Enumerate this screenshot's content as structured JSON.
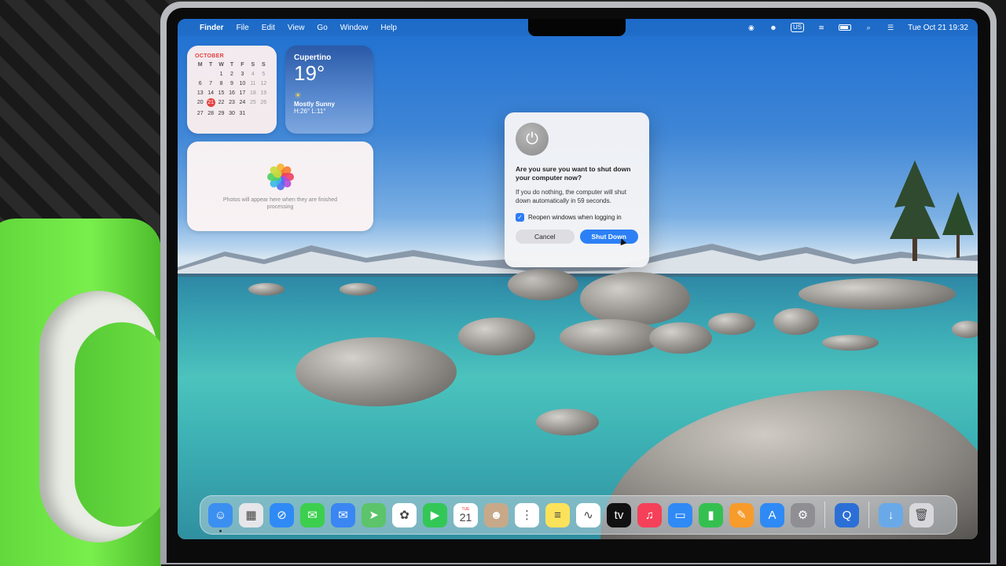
{
  "menubar": {
    "apple_icon": "apple-icon",
    "app_name": "Finder",
    "menus": [
      "File",
      "Edit",
      "View",
      "Go",
      "Window",
      "Help"
    ],
    "input_source": "US",
    "datetime": "Tue Oct 21  19:32"
  },
  "calendar_widget": {
    "month": "OCTOBER",
    "weekdays": [
      "M",
      "T",
      "W",
      "T",
      "F",
      "S",
      "S"
    ],
    "weeks": [
      [
        "",
        "",
        "1",
        "2",
        "3",
        "4",
        "5"
      ],
      [
        "6",
        "7",
        "8",
        "9",
        "10",
        "11",
        "12"
      ],
      [
        "13",
        "14",
        "15",
        "16",
        "17",
        "18",
        "19"
      ],
      [
        "20",
        "21",
        "22",
        "23",
        "24",
        "25",
        "26"
      ],
      [
        "27",
        "28",
        "29",
        "30",
        "31",
        "",
        ""
      ]
    ],
    "today": "21"
  },
  "weather_widget": {
    "city": "Cupertino",
    "temperature": "19°",
    "condition": "Mostly Sunny",
    "high_low": "H:26° L:11°",
    "icon": "sun-icon"
  },
  "photos_widget": {
    "message": "Photos will appear here when they are finished processing"
  },
  "dialog": {
    "icon": "power-icon",
    "title": "Are you sure you want to shut down your computer now?",
    "message": "If you do nothing, the computer will shut down automatically in 59 seconds.",
    "checkbox_label": "Reopen windows when logging in",
    "checkbox_checked": true,
    "cancel_label": "Cancel",
    "confirm_label": "Shut Down"
  },
  "dock": {
    "apps": [
      {
        "name": "finder",
        "color": "#3b8ff0",
        "glyph": "☺"
      },
      {
        "name": "launchpad",
        "color": "#e6e6ea",
        "glyph": "▦"
      },
      {
        "name": "safari",
        "color": "#2f8af5",
        "glyph": "⊘"
      },
      {
        "name": "messages",
        "color": "#3ccf4e",
        "glyph": "✉"
      },
      {
        "name": "mail",
        "color": "#3a86f2",
        "glyph": "✉"
      },
      {
        "name": "maps",
        "color": "#5cc46a",
        "glyph": "➤"
      },
      {
        "name": "photos",
        "color": "#ffffff",
        "glyph": "✿"
      },
      {
        "name": "facetime",
        "color": "#32c756",
        "glyph": "▶"
      },
      {
        "name": "calendar",
        "color": "#ffffff",
        "glyph": "21",
        "sub": "TUE"
      },
      {
        "name": "contacts",
        "color": "#c7a98a",
        "glyph": "☻"
      },
      {
        "name": "reminders",
        "color": "#ffffff",
        "glyph": "⋮"
      },
      {
        "name": "notes",
        "color": "#fce25a",
        "glyph": "≡"
      },
      {
        "name": "freeform",
        "color": "#ffffff",
        "glyph": "∿"
      },
      {
        "name": "tv",
        "color": "#111111",
        "glyph": "tv"
      },
      {
        "name": "music",
        "color": "#f5405a",
        "glyph": "♫"
      },
      {
        "name": "keynote",
        "color": "#2f8af5",
        "glyph": "▭"
      },
      {
        "name": "numbers",
        "color": "#34c04f",
        "glyph": "▮"
      },
      {
        "name": "pages",
        "color": "#f79b2a",
        "glyph": "✎"
      },
      {
        "name": "app-store",
        "color": "#2f8af5",
        "glyph": "A"
      },
      {
        "name": "system-settings",
        "color": "#8e8e93",
        "glyph": "⚙"
      }
    ],
    "extra": [
      {
        "name": "quicktime",
        "color": "#2b6fd6",
        "glyph": "Q"
      }
    ],
    "trailing": [
      {
        "name": "downloads-folder",
        "color": "#6aa9e8",
        "glyph": "↓"
      },
      {
        "name": "trash",
        "color": "#d8d8dc",
        "glyph": "🗑"
      }
    ]
  }
}
